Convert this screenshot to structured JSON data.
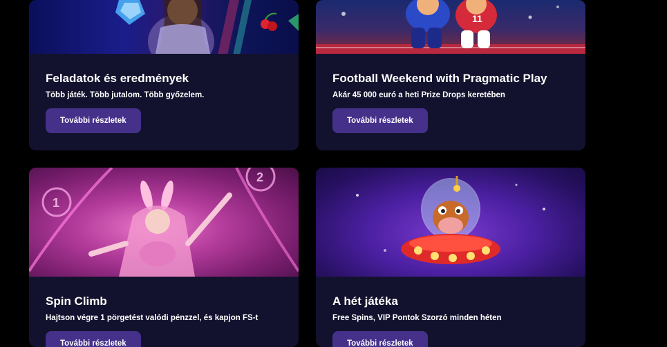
{
  "cards": [
    {
      "title": "Feladatok és eredmények",
      "subtitle": "Több játék. Több jutalom. Több győzelem.",
      "button": "További részletek"
    },
    {
      "title": "Football Weekend with Pragmatic Play",
      "subtitle": "Akár 45 000 euró a heti Prize Drops keretében",
      "button": "További részletek"
    },
    {
      "title": "Spin Climb",
      "subtitle": "Hajtson végre 1 pörgetést valódi pénzzel, és kapjon FS-t",
      "button": "További részletek",
      "image_numbers": [
        "1",
        "2"
      ]
    },
    {
      "title": "A hét játéka",
      "subtitle": "Free Spins, VIP Pontok Szorzó minden héten",
      "button": "További részletek"
    }
  ],
  "colors": {
    "page_background": "#000000",
    "card_background": "#13122e",
    "button_background": "#45308a",
    "text": "#ffffff"
  }
}
